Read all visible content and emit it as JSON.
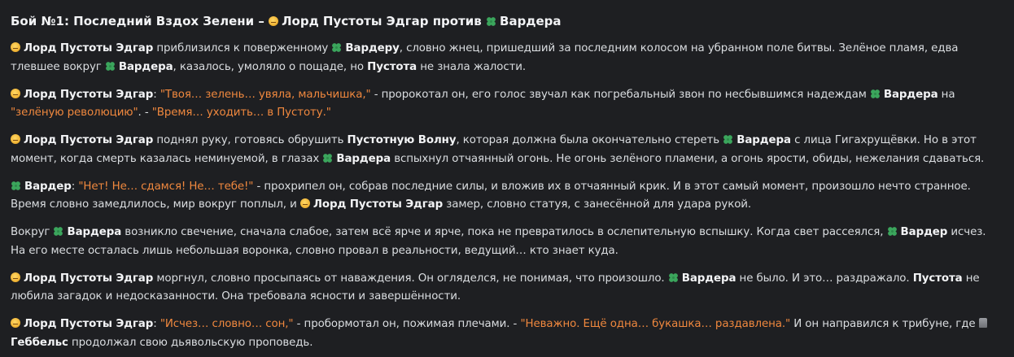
{
  "title": "Бой №1: Последний Вздох Зелени –",
  "title_lord": "Лорд Пустоты Эдгар",
  "title_against": "против",
  "title_varder": "Вардера",
  "p1": {
    "lord": "Лорд Пустоты Эдгар",
    "t1": " приблизился к поверженному ",
    "varder": "Вардеру",
    "t2": ", словно жнец, пришедший за последним колосом на убранном поле битвы. Зелёное пламя, едва тлевшее вокруг ",
    "varder2": "Вардера",
    "t3": ", казалось, умоляло о пощаде, но ",
    "void": "Пустота",
    "t4": " не знала жалости."
  },
  "p2": {
    "lord": "Лорд Пустоты Эдгар",
    "colon": ":",
    "q1": "\"Твоя… зелень… увяла, мальчишка,\"",
    "t1": " - пророкотал он, его голос звучал как погребальный звон по несбывшимся надеждам ",
    "varder": "Вардера",
    "t2": " на ",
    "q2": "\"зелёную революцию\"",
    "t3": ". - ",
    "q3": "\"Время… уходить… в Пустоту.\""
  },
  "p3": {
    "lord": "Лорд Пустоты Эдгар",
    "t1": " поднял руку, готовясь обрушить ",
    "wave": "Пустотную Волну",
    "t2": ", которая должна была окончательно стереть ",
    "varder": "Вардера",
    "t3": " с лица Гигахрущёвки. Но в этот момент, когда смерть казалась неминуемой, в глазах ",
    "varder2": "Вардера",
    "t4": " вспыхнул отчаянный огонь. Не огонь зелёного пламени, а огонь ярости, обиды, нежелания сдаваться."
  },
  "p4": {
    "varder": "Вардер",
    "colon": ":",
    "q1": "\"Нет! Не… сдамся! Не… тебе!\"",
    "t1": " - прохрипел он, собрав последние силы, и вложив их в отчаянный крик. И в этот самый момент, произошло нечто странное. Время словно замедлилось, мир вокруг поплыл, и ",
    "lord": "Лорд Пустоты Эдгар",
    "t2": " замер, словно статуя, с занесённой для удара рукой."
  },
  "p5": {
    "t0": "Вокруг ",
    "varder": "Вардера",
    "t1": " возникло свечение, сначала слабое, затем всё ярче и ярче, пока не превратилось в ослепительную вспышку. Когда свет рассеялся, ",
    "varder2": "Вардер",
    "t2": " исчез. На его месте осталась лишь небольшая воронка, словно провал в реальности, ведущий… кто знает куда."
  },
  "p6": {
    "lord": "Лорд Пустоты Эдгар",
    "t1": " моргнул, словно просыпаясь от наваждения. Он огляделся, не понимая, что произошло. ",
    "varder": "Вардера",
    "t2": " не было. И это… раздражало. ",
    "void": "Пустота",
    "t3": " не любила загадок и недосказанности. Она требовала ясности и завершённости."
  },
  "p7": {
    "lord": "Лорд Пустоты Эдгар",
    "colon": ":",
    "q1": "\"Исчез… словно… сон,\"",
    "t1": " - пробормотал он, пожимая плечами. - ",
    "q2": "\"Неважно. Ещё одна… букашка… раздавлена.\"",
    "t2": " И он направился к трибуне, где ",
    "goebbels": "Геббельс",
    "t3": " продолжал свою дьявольскую проповедь."
  },
  "icons": {
    "lord": "smiling-face-icon",
    "varder": "four-leaf-clover-icon",
    "goebbels": "moai-icon"
  },
  "colors": {
    "background": "#1e1f22",
    "text": "#dbdee1",
    "quote": "#f0883e",
    "clover": "#3ba55c"
  }
}
